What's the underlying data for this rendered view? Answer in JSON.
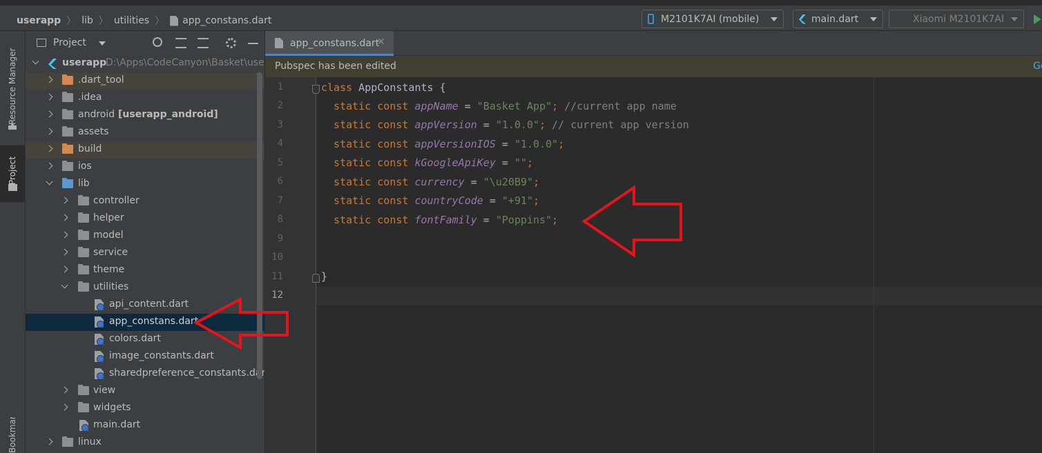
{
  "breadcrumb": {
    "items": [
      "userapp",
      "lib",
      "utilities",
      "app_constans.dart"
    ]
  },
  "toolbar": {
    "device": "M2101K7AI (mobile)",
    "run_config": "main.dart",
    "target_device": "Xiaomi M2101K7AI"
  },
  "sidebar_strip": {
    "resource_manager": "Resource Manager",
    "project": "Project",
    "bookmarks": "Bookmarks"
  },
  "project_panel": {
    "title": "Project",
    "root_name": "userapp",
    "root_path": "D:\\Apps\\CodeCanyon\\Basket\\usera",
    "tree": [
      {
        "label": "userapp",
        "path": "D:\\Apps\\CodeCanyon\\Basket\\usera"
      },
      {
        "label": ".dart_tool"
      },
      {
        "label": ".idea"
      },
      {
        "label": "android",
        "extra": "[userapp_android]"
      },
      {
        "label": "assets"
      },
      {
        "label": "build"
      },
      {
        "label": "ios"
      },
      {
        "label": "lib"
      },
      {
        "label": "controller"
      },
      {
        "label": "helper"
      },
      {
        "label": "model"
      },
      {
        "label": "service"
      },
      {
        "label": "theme"
      },
      {
        "label": "utilities"
      },
      {
        "label": "api_content.dart"
      },
      {
        "label": "app_constans.dart"
      },
      {
        "label": "colors.dart"
      },
      {
        "label": "image_constants.dart"
      },
      {
        "label": "sharedpreference_constants.dart"
      },
      {
        "label": "view"
      },
      {
        "label": "widgets"
      },
      {
        "label": "main.dart"
      },
      {
        "label": "linux"
      }
    ]
  },
  "editor": {
    "tab_label": "app_constans.dart",
    "banner": "Pubspec has been edited",
    "banner_link": "Ge",
    "line_numbers": [
      "1",
      "2",
      "3",
      "4",
      "5",
      "6",
      "7",
      "8",
      "9",
      "10",
      "11",
      "12"
    ],
    "code": {
      "l1_kw": "class",
      "l1_name": " AppConstants {",
      "static_const": "  static const ",
      "l2_field": "appName",
      "l2_val": "\"Basket App\"",
      "l2_comment": " //current app name",
      "l3_field": "appVersion",
      "l3_val": "\"1.0.0\"",
      "l3_comment": " // current app version",
      "l4_field": "appVersionIOS",
      "l4_val": "\"1.0.0\"",
      "l5_field": "kGoogleApiKey",
      "l5_val": "\"\"",
      "l6_field": "currency",
      "l6_val": "\"\\u20B9\"",
      "l7_field": "countryCode",
      "l7_val": "\"+91\"",
      "l8_field": "fontFamily",
      "l8_val": "\"Poppins\"",
      "eq": " = ",
      "semi": ";",
      "close": "}"
    }
  },
  "colors": {
    "annotation_arrow": "#e8141d"
  }
}
